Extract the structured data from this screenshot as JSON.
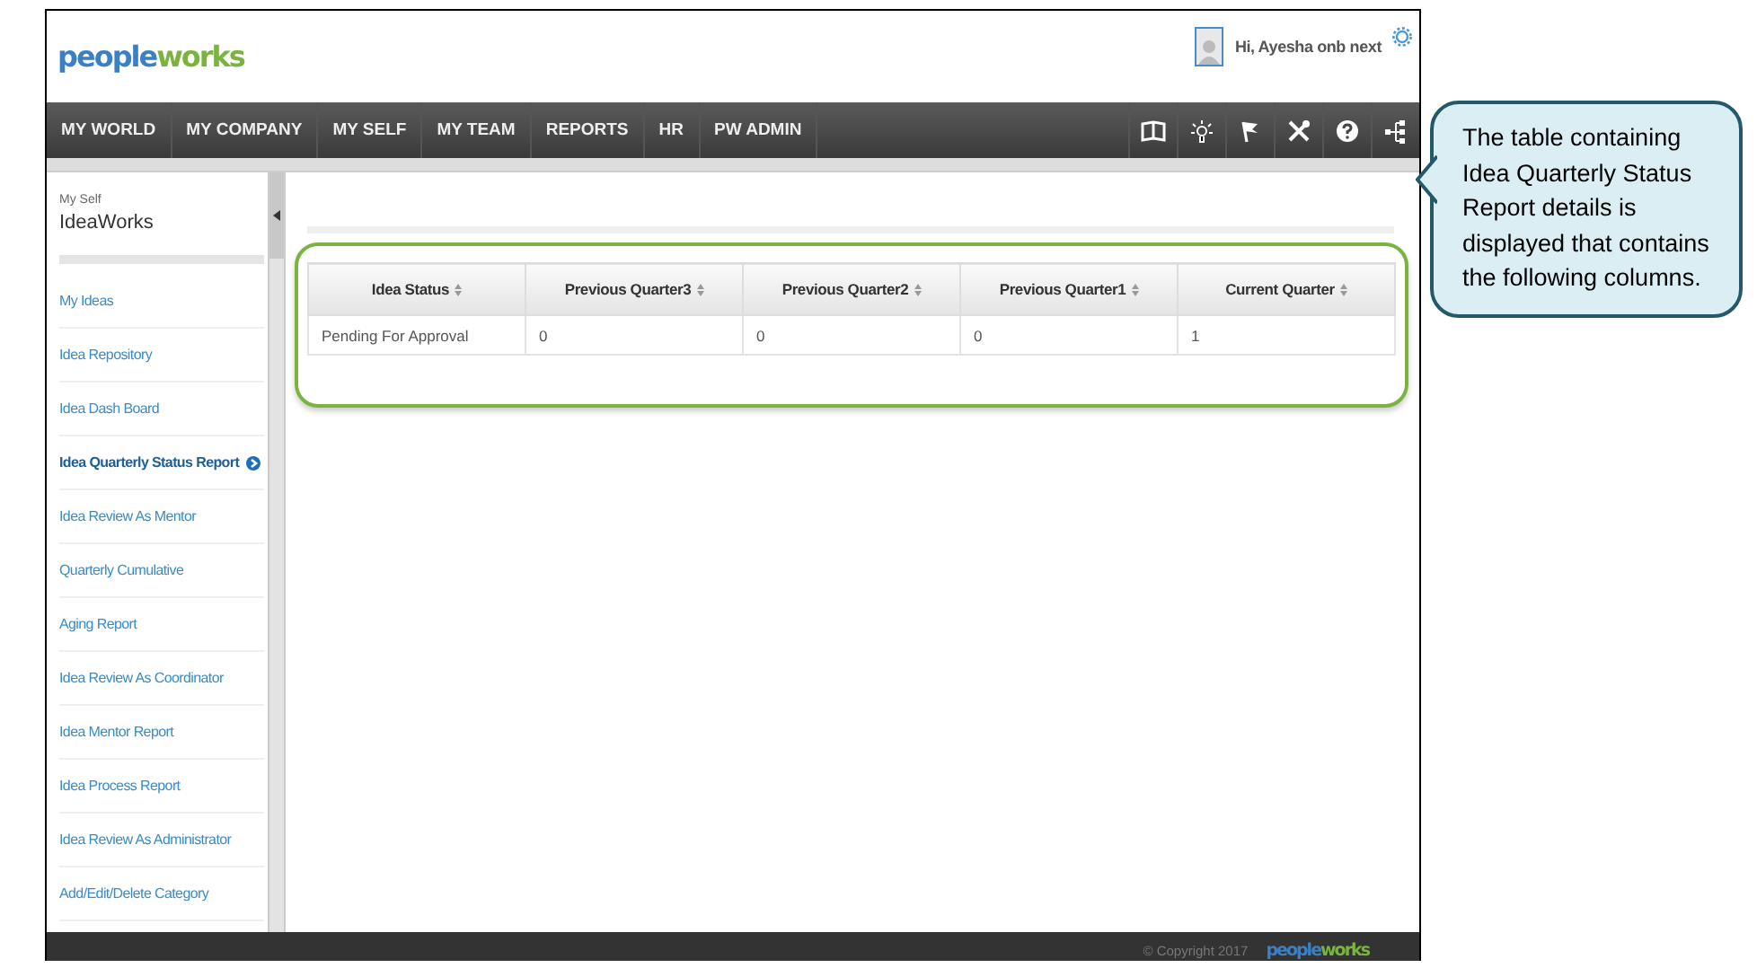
{
  "header": {
    "logo": "peopleworks",
    "greeting": "Hi, Ayesha onb next"
  },
  "nav": [
    {
      "label": "MY WORLD"
    },
    {
      "label": "MY COMPANY"
    },
    {
      "label": "MY SELF"
    },
    {
      "label": "MY TEAM"
    },
    {
      "label": "REPORTS"
    },
    {
      "label": "HR"
    },
    {
      "label": "PW ADMIN"
    }
  ],
  "sidebar": {
    "section": "My Self",
    "title": "IdeaWorks",
    "items": [
      {
        "label": "My Ideas",
        "selected": false
      },
      {
        "label": "Idea Repository",
        "selected": false
      },
      {
        "label": "Idea Dash Board",
        "selected": false
      },
      {
        "label": "Idea Quarterly Status Report",
        "selected": true
      },
      {
        "label": "Idea Review As Mentor",
        "selected": false
      },
      {
        "label": "Quarterly Cumulative",
        "selected": false
      },
      {
        "label": "Aging Report",
        "selected": false
      },
      {
        "label": "Idea Review As Coordinator",
        "selected": false
      },
      {
        "label": "Idea Mentor Report",
        "selected": false
      },
      {
        "label": "Idea Process Report",
        "selected": false
      },
      {
        "label": "Idea Review As Administrator",
        "selected": false
      },
      {
        "label": "Add/Edit/Delete Category",
        "selected": false
      }
    ]
  },
  "table": {
    "columns": [
      "Idea Status",
      "Previous Quarter3",
      "Previous Quarter2",
      "Previous Quarter1",
      "Current Quarter"
    ],
    "rows": [
      [
        "Pending For Approval",
        "0",
        "0",
        "0",
        "1"
      ]
    ]
  },
  "footer": {
    "copyright": "© Copyright 2017",
    "logo": "peopleworks"
  },
  "callout": {
    "text": "The table containing Idea Quarterly Status Report details is displayed that contains the following columns."
  }
}
